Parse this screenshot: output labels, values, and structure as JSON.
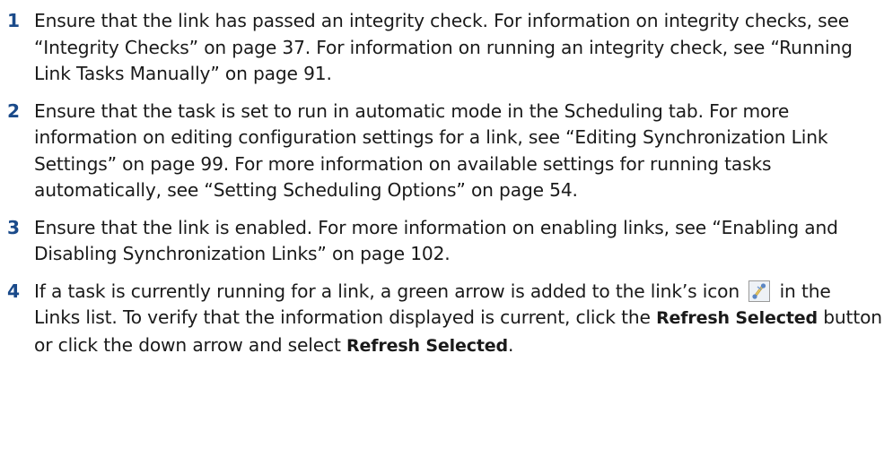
{
  "steps": [
    {
      "number": "1",
      "text": "Ensure that the link has passed an integrity check. For information on integrity checks, see “Integrity Checks” on page 37. For information on running an integrity check, see “Running Link Tasks Manually” on page 91."
    },
    {
      "number": "2",
      "text": "Ensure that the task is set to run in automatic mode in the Scheduling tab. For more information on editing configuration settings for a link, see “Editing Synchronization Link Settings” on page 99. For more information on available settings for running tasks automatically, see “Setting Scheduling Options” on page 54."
    },
    {
      "number": "3",
      "text": "Ensure that the link is enabled. For more information on enabling links, see “Enabling and Disabling Synchronization Links” on page 102."
    },
    {
      "number": "4",
      "text_before_icon": "If a task is currently running for a link, a green arrow is added to the link’s icon",
      "icon": "link-icon",
      "text_after_icon": "in the Links list. To verify that the information displayed is current, click the",
      "bold_1": "Refresh Selected",
      "text_mid": "button or click the down arrow and select",
      "bold_2": "Refresh Selected",
      "text_end": "."
    }
  ],
  "colors": {
    "step_number": "#1a4a8a",
    "body_text": "#1a1a1a"
  }
}
